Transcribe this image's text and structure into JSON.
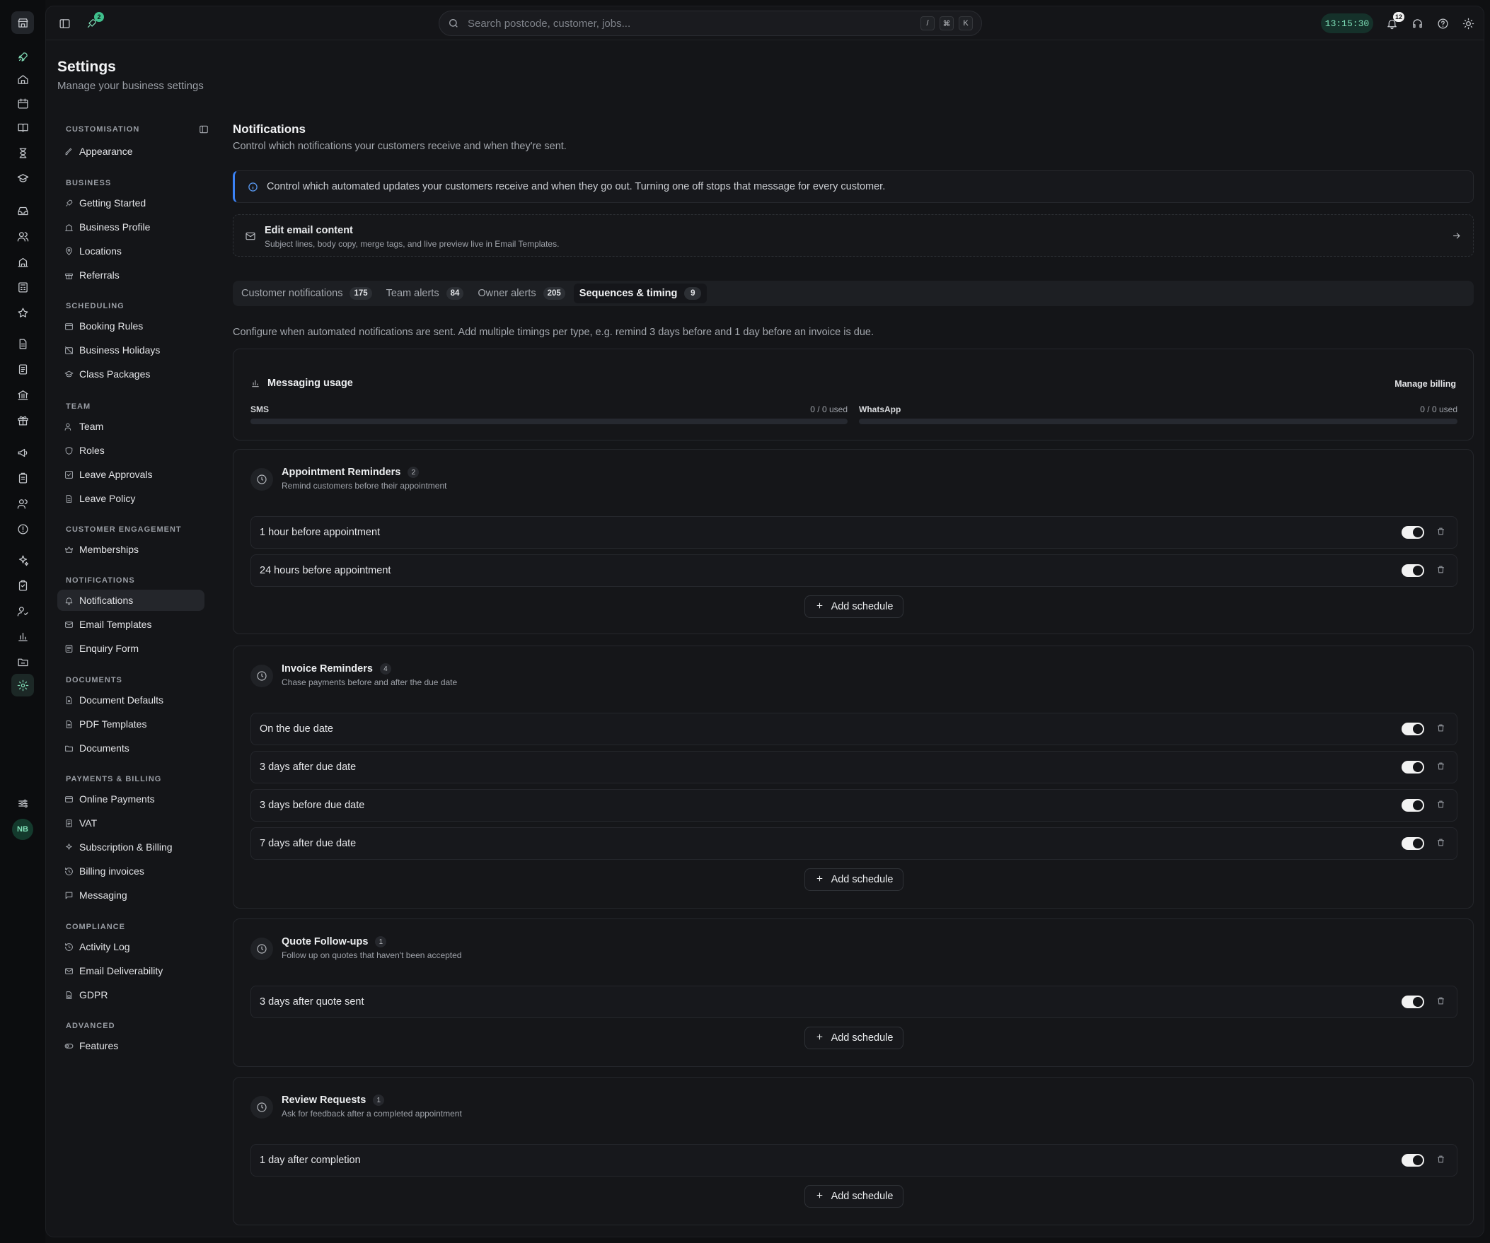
{
  "topbar": {
    "rocket_badge": "2",
    "search_placeholder": "Search postcode, customer, jobs...",
    "shortcut_keys": [
      "/",
      "⌘",
      "K"
    ],
    "clock": "13:15:30",
    "notifications_badge": "12"
  },
  "rail": {
    "avatar_initials": "NB"
  },
  "header": {
    "title": "Settings",
    "subtitle": "Manage your business settings"
  },
  "sidebar": {
    "groups": [
      {
        "label": "CUSTOMISATION",
        "items": [
          "Appearance"
        ]
      },
      {
        "label": "BUSINESS",
        "items": [
          "Getting Started",
          "Business Profile",
          "Locations",
          "Referrals"
        ]
      },
      {
        "label": "SCHEDULING",
        "items": [
          "Booking Rules",
          "Business Holidays",
          "Class Packages"
        ]
      },
      {
        "label": "TEAM",
        "items": [
          "Team",
          "Roles",
          "Leave Approvals",
          "Leave Policy"
        ]
      },
      {
        "label": "CUSTOMER ENGAGEMENT",
        "items": [
          "Memberships"
        ]
      },
      {
        "label": "NOTIFICATIONS",
        "items": [
          "Notifications",
          "Email Templates",
          "Enquiry Form"
        ]
      },
      {
        "label": "DOCUMENTS",
        "items": [
          "Document Defaults",
          "PDF Templates",
          "Documents"
        ]
      },
      {
        "label": "PAYMENTS & BILLING",
        "items": [
          "Online Payments",
          "VAT",
          "Subscription & Billing",
          "Billing invoices",
          "Messaging"
        ]
      },
      {
        "label": "COMPLIANCE",
        "items": [
          "Activity Log",
          "Email Deliverability",
          "GDPR"
        ]
      },
      {
        "label": "ADVANCED",
        "items": [
          "Features"
        ]
      }
    ],
    "active_item": "Notifications"
  },
  "content": {
    "title": "Notifications",
    "subtitle": "Control which notifications your customers receive and when they're sent.",
    "info_text": "Control which automated updates your customers receive and when they go out. Turning one off stops that message for every customer.",
    "edit_email": {
      "title": "Edit email content",
      "subtitle": "Subject lines, body copy, merge tags, and live preview live in Email Templates."
    },
    "tabs": [
      {
        "label": "Customer notifications",
        "count": "175"
      },
      {
        "label": "Team alerts",
        "count": "84"
      },
      {
        "label": "Owner alerts",
        "count": "205"
      },
      {
        "label": "Sequences & timing",
        "count": "9"
      }
    ],
    "active_tab": "Sequences & timing",
    "config_text": "Configure when automated notifications are sent. Add multiple timings per type, e.g. remind 3 days before and 1 day before an invoice is due.",
    "usage": {
      "title": "Messaging usage",
      "manage_label": "Manage billing",
      "meters": [
        {
          "label": "SMS",
          "used": "0 / 0 used",
          "fraction": 0
        },
        {
          "label": "WhatsApp",
          "used": "0 / 0 used",
          "fraction": 0
        }
      ]
    },
    "add_label": "Add schedule",
    "sections": [
      {
        "title": "Appointment Reminders",
        "count": "2",
        "subtitle": "Remind customers before their appointment",
        "rows": [
          {
            "label": "1 hour before appointment",
            "enabled": true
          },
          {
            "label": "24 hours before appointment",
            "enabled": true
          }
        ]
      },
      {
        "title": "Invoice Reminders",
        "count": "4",
        "subtitle": "Chase payments before and after the due date",
        "rows": [
          {
            "label": "On the due date",
            "enabled": true
          },
          {
            "label": "3 days after due date",
            "enabled": true
          },
          {
            "label": "3 days before due date",
            "enabled": true
          },
          {
            "label": "7 days after due date",
            "enabled": true
          }
        ]
      },
      {
        "title": "Quote Follow-ups",
        "count": "1",
        "subtitle": "Follow up on quotes that haven't been accepted",
        "rows": [
          {
            "label": "3 days after quote sent",
            "enabled": true
          }
        ]
      },
      {
        "title": "Review Requests",
        "count": "1",
        "subtitle": "Ask for feedback after a completed appointment",
        "rows": [
          {
            "label": "1 day after completion",
            "enabled": true
          }
        ]
      }
    ]
  },
  "colors": {
    "accent_green": "#3fbf8c",
    "info_blue": "#3b82f6",
    "background": "#0f1012"
  }
}
